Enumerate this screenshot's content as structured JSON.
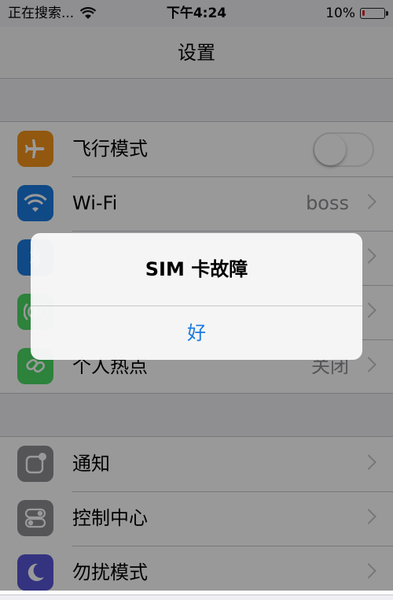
{
  "status_bar": {
    "carrier": "正在搜索...",
    "time": "下午4:24",
    "battery_percent": "10%",
    "battery_level": 0.1,
    "battery_color": "#e0262b"
  },
  "nav": {
    "title": "设置"
  },
  "settings_group1": [
    {
      "label": "飞行模式",
      "icon": "airplane-icon",
      "icon_color": "#f3931c",
      "control": "toggle",
      "toggle_on": false
    },
    {
      "label": "Wi-Fi",
      "value": "boss",
      "icon": "wifi-icon",
      "icon_color": "#1a7ae0"
    },
    {
      "label": "",
      "icon": "bluetooth-icon",
      "icon_color": "#1a7ae0"
    },
    {
      "label": "",
      "icon": "cellular-icon",
      "icon_color": "#4cd964"
    },
    {
      "label": "个人热点",
      "value": "关闭",
      "icon": "hotspot-icon",
      "icon_color": "#4cd964"
    }
  ],
  "settings_group2": [
    {
      "label": "通知",
      "icon": "notifications-icon",
      "icon_color": "#8e8e93"
    },
    {
      "label": "控制中心",
      "icon": "control-center-icon",
      "icon_color": "#8e8e93"
    },
    {
      "label": "勿扰模式",
      "icon": "moon-icon",
      "icon_color": "#5856d6"
    }
  ],
  "alert": {
    "title": "SIM 卡故障",
    "button_label": "好",
    "button_color": "#1a7ae0"
  }
}
